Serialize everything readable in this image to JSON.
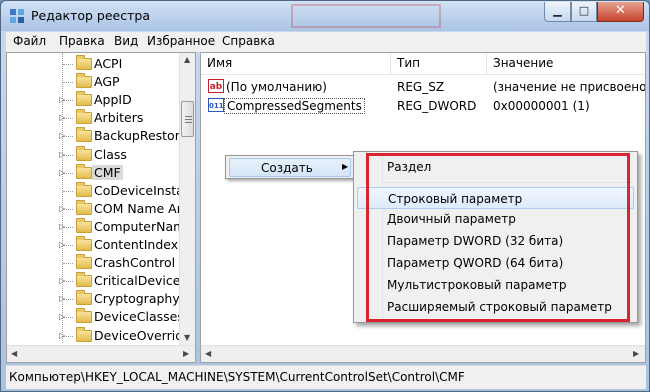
{
  "window": {
    "title": "Редактор реестра"
  },
  "menubar": [
    "Файл",
    "Правка",
    "Вид",
    "Избранное",
    "Справка"
  ],
  "tree": {
    "items": [
      {
        "label": "ACPI",
        "expandable": false
      },
      {
        "label": "AGP",
        "expandable": false
      },
      {
        "label": "AppID",
        "expandable": true
      },
      {
        "label": "Arbiters",
        "expandable": true
      },
      {
        "label": "BackupRestore",
        "expandable": true
      },
      {
        "label": "Class",
        "expandable": true
      },
      {
        "label": "CMF",
        "expandable": true,
        "selected": true
      },
      {
        "label": "CoDeviceInstalle",
        "expandable": false
      },
      {
        "label": "COM Name Arb",
        "expandable": true
      },
      {
        "label": "ComputerName",
        "expandable": true
      },
      {
        "label": "ContentIndex",
        "expandable": true
      },
      {
        "label": "CrashControl",
        "expandable": false
      },
      {
        "label": "CriticalDeviceDa",
        "expandable": true
      },
      {
        "label": "Cryptography",
        "expandable": true
      },
      {
        "label": "DeviceClasses",
        "expandable": true
      },
      {
        "label": "DeviceOverrides",
        "expandable": true
      }
    ]
  },
  "list": {
    "columns": [
      "Имя",
      "Тип",
      "Значение"
    ],
    "rows": [
      {
        "icon": "string-value-icon",
        "name": "(По умолчанию)",
        "type": "REG_SZ",
        "value": "(значение не присвоено)"
      },
      {
        "icon": "binary-value-icon",
        "name": "CompressedSegments",
        "type": "REG_DWORD",
        "value": "0x00000001 (1)"
      }
    ]
  },
  "context_menu": {
    "item": "Создать"
  },
  "submenu": {
    "items": [
      "Раздел",
      "Строковый параметр",
      "Двоичный параметр",
      "Параметр DWORD (32 бита)",
      "Параметр QWORD (64 бита)",
      "Мультистроковый параметр",
      "Расширяемый строковый параметр"
    ],
    "hovered_index": 1
  },
  "statusbar": {
    "path": "Компьютер\\HKEY_LOCAL_MACHINE\\SYSTEM\\CurrentControlSet\\Control\\CMF"
  },
  "colors": {
    "highlight_box": "#d8252f",
    "title_bg": "#b9cfe9",
    "close_button": "#c5442c"
  }
}
